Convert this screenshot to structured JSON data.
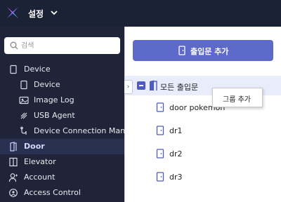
{
  "app": {
    "title": "설정"
  },
  "search": {
    "placeholder": "검색"
  },
  "sidebar": {
    "items": [
      {
        "label": "Device"
      },
      {
        "label": "Device"
      },
      {
        "label": "Image Log"
      },
      {
        "label": "USB Agent"
      },
      {
        "label": "Device Connection Man"
      },
      {
        "label": "Door"
      },
      {
        "label": "Elevator"
      },
      {
        "label": "Account"
      },
      {
        "label": "Access Control"
      }
    ]
  },
  "main": {
    "add_button_label": "출입문 추가",
    "tree": {
      "root_label": "모든 출입문",
      "items": [
        {
          "label": "door pokemon"
        },
        {
          "label": "dr1"
        },
        {
          "label": "dr2"
        },
        {
          "label": "dr3"
        }
      ]
    },
    "context_menu": {
      "item_label": "그룹 추가"
    }
  },
  "colors": {
    "topbar": "#1b2235",
    "sidebar": "#1f2438",
    "accent": "#5d6ac9",
    "selected_row": "#e9ecfb",
    "door_icon": "#4d5bc3"
  }
}
